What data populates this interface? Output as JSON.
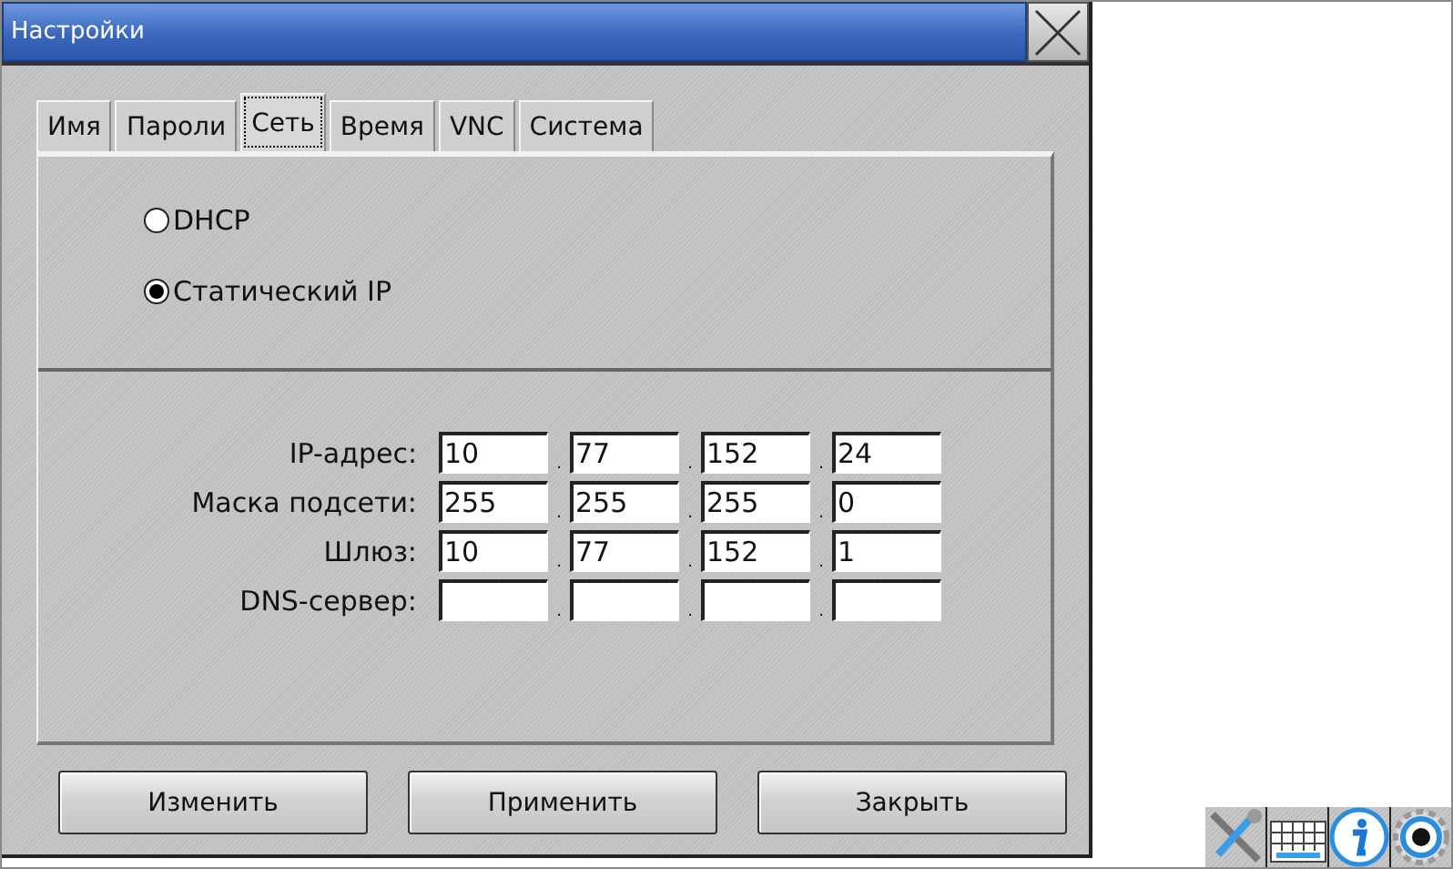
{
  "window": {
    "title": "Настройки"
  },
  "tabs": [
    {
      "label": "Имя",
      "selected": false
    },
    {
      "label": "Пароли",
      "selected": false
    },
    {
      "label": "Сеть",
      "selected": true
    },
    {
      "label": "Время",
      "selected": false
    },
    {
      "label": "VNC",
      "selected": false
    },
    {
      "label": "Система",
      "selected": false
    }
  ],
  "network_mode": [
    {
      "label": "DHCP",
      "selected": false
    },
    {
      "label": "Статический IP",
      "selected": true
    }
  ],
  "address_fields": [
    {
      "label": "IP-адрес:",
      "octets": [
        "10",
        "77",
        "152",
        "24"
      ],
      "separators": [
        ".",
        ".",
        "."
      ]
    },
    {
      "label": "Маска подсети:",
      "octets": [
        "255",
        "255",
        "255",
        "0"
      ],
      "separators": [
        ".",
        ".",
        "."
      ]
    },
    {
      "label": "Шлюз:",
      "octets": [
        "10",
        "77",
        "152",
        "1"
      ],
      "separators": [
        ".",
        ".",
        "."
      ]
    },
    {
      "label": "DNS-сервер:",
      "separators": [
        ".",
        ".",
        "."
      ]
    }
  ],
  "buttons": [
    "Изменить",
    "Применить",
    "Закрыть"
  ]
}
